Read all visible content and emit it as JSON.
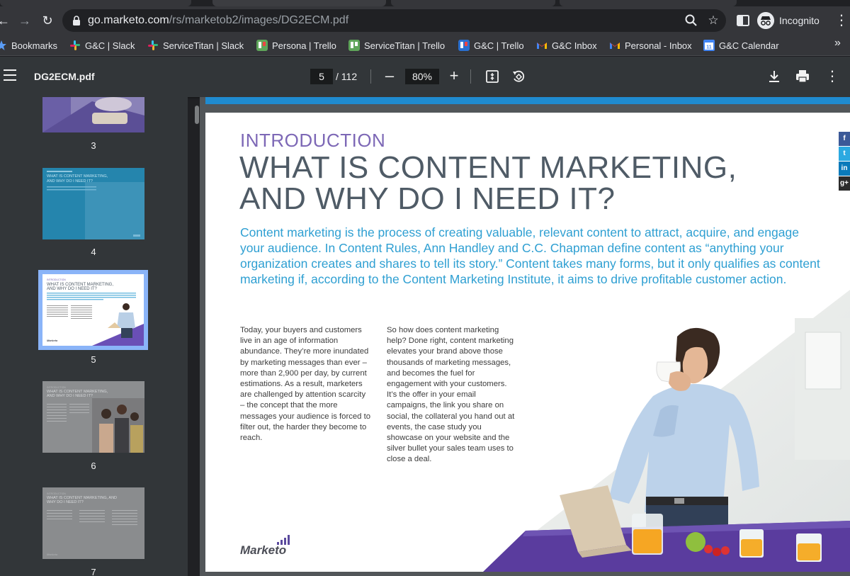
{
  "browser": {
    "url_host": "go.marketo.com",
    "url_path": "/rs/marketob2/images/DG2ECM.pdf",
    "profile_label": "Incognito",
    "bookmarks": [
      {
        "label": "Bookmarks",
        "icon": "star-icon"
      },
      {
        "label": "G&C | Slack",
        "icon": "slack-icon"
      },
      {
        "label": "ServiceTitan | Slack",
        "icon": "slack-icon"
      },
      {
        "label": "Persona | Trello",
        "icon": "trello-icon"
      },
      {
        "label": "ServiceTitan | Trello",
        "icon": "trello-icon"
      },
      {
        "label": "G&C | Trello",
        "icon": "trello-icon"
      },
      {
        "label": "G&C Inbox",
        "icon": "gmail-icon"
      },
      {
        "label": "Personal - Inbox",
        "icon": "gmail-icon"
      },
      {
        "label": "G&C Calendar",
        "icon": "calendar-icon"
      }
    ]
  },
  "pdf": {
    "filename": "DG2ECM.pdf",
    "current_page": "5",
    "total_pages": "/ 112",
    "zoom": "80%"
  },
  "thumbnails": [
    {
      "num": "3"
    },
    {
      "num": "4",
      "title": "WHAT IS CONTENT MARKETING, AND WHY DO I NEED IT?"
    },
    {
      "num": "5",
      "title": "WHAT IS CONTENT MARKETING, AND WHY DO I NEED IT?",
      "selected": true
    },
    {
      "num": "6",
      "title": "WHAT IS CONTENT MARKETING, AND WHY DO I NEED IT?"
    },
    {
      "num": "7",
      "title": "WHAT IS CONTENT MARKETING, AND WHY DO I NEED IT?"
    }
  ],
  "page": {
    "section": "INTRODUCTION",
    "headline_1": "WHAT IS CONTENT MARKETING,",
    "headline_2": "AND WHY DO I NEED IT?",
    "lead": "Content marketing is the process of creating valuable, relevant content to attract, acquire, and engage your audience. In Content Rules, Ann Handley and C.C. Chapman define content as “anything your organization creates and shares to tell its story.” Content takes many forms, but it only qualifies as content marketing if, according to the Content Marketing Institute, it aims to drive profitable customer action.",
    "col1": "Today, your buyers and customers live in an age of information abundance. They’re more inundated by marketing messages than ever – more than 2,900 per day, by current estimations. As a result, marketers are challenged by attention scarcity – the concept that the more messages your audience is forced to filter out, the harder they become to reach.",
    "col2": "So how does content marketing help? Done right, content marketing elevates your brand above those thousands of marketing messages, and becomes the fuel for engagement with your customers. It’s the offer in your email campaigns, the link you share on social, the collateral you hand out at events, the case study you showcase on your website and the silver bullet your sales team uses to close a deal.",
    "logo": "Marketo",
    "social": [
      "f",
      "t",
      "in",
      "g+"
    ]
  },
  "colors": {
    "intro_purple": "#7d68b6",
    "headline_gray": "#4f5b66",
    "lead_blue": "#2e9fd2",
    "selection_blue": "#8ab4f8"
  }
}
